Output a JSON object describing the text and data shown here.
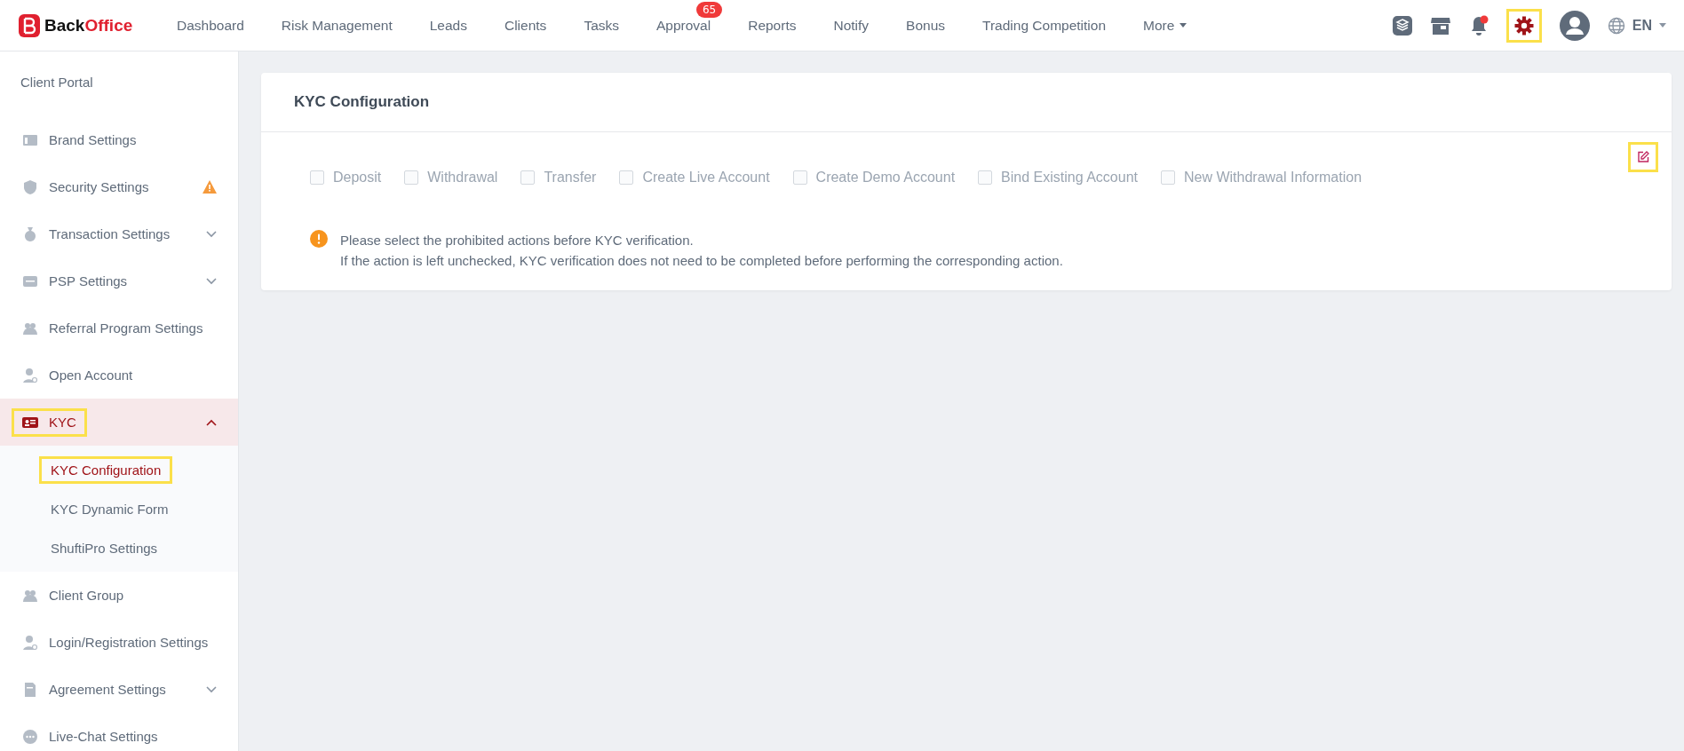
{
  "brand": {
    "name_plain": "Back",
    "name_accent": "Office"
  },
  "nav": [
    {
      "label": "Dashboard"
    },
    {
      "label": "Risk Management"
    },
    {
      "label": "Leads"
    },
    {
      "label": "Clients"
    },
    {
      "label": "Tasks"
    },
    {
      "label": "Approval",
      "badge": "65"
    },
    {
      "label": "Reports"
    },
    {
      "label": "Notify"
    },
    {
      "label": "Bonus"
    },
    {
      "label": "Trading Competition"
    },
    {
      "label": "More",
      "dropdown": true
    }
  ],
  "toolbar": {
    "notification_dot": true,
    "settings_highlighted": true,
    "language": "EN"
  },
  "sidebar": {
    "heading": "Client Portal",
    "items": [
      {
        "label": "Brand Settings",
        "kind": "link",
        "selected": false,
        "highlighted": false
      },
      {
        "label": "Security Settings",
        "kind": "link",
        "selected": false,
        "highlighted": false,
        "warning": true
      },
      {
        "label": "Transaction Settings",
        "kind": "group",
        "expanded": false,
        "selected": false,
        "highlighted": false
      },
      {
        "label": "PSP Settings",
        "kind": "group",
        "expanded": false,
        "selected": false,
        "highlighted": false
      },
      {
        "label": "Referral Program Settings",
        "kind": "link",
        "selected": false,
        "highlighted": false
      },
      {
        "label": "Open Account",
        "kind": "link",
        "selected": false,
        "highlighted": false
      },
      {
        "label": "KYC",
        "kind": "group",
        "expanded": true,
        "selected": true,
        "highlighted": true,
        "children": [
          {
            "label": "KYC Configuration",
            "selected": true,
            "highlighted": true
          },
          {
            "label": "KYC Dynamic Form",
            "selected": false,
            "highlighted": false
          },
          {
            "label": "ShuftiPro Settings",
            "selected": false,
            "highlighted": false
          }
        ]
      },
      {
        "label": "Client Group",
        "kind": "link",
        "selected": false,
        "highlighted": false
      },
      {
        "label": "Login/Registration Settings",
        "kind": "link",
        "selected": false,
        "highlighted": false
      },
      {
        "label": "Agreement Settings",
        "kind": "group",
        "expanded": false,
        "selected": false,
        "highlighted": false
      },
      {
        "label": "Live-Chat Settings",
        "kind": "link",
        "selected": false,
        "highlighted": false
      }
    ]
  },
  "card": {
    "title": "KYC Configuration",
    "edit_highlighted": true,
    "options": [
      {
        "label": "Deposit",
        "checked": false,
        "disabled": true
      },
      {
        "label": "Withdrawal",
        "checked": false,
        "disabled": true
      },
      {
        "label": "Transfer",
        "checked": false,
        "disabled": true
      },
      {
        "label": "Create Live Account",
        "checked": false,
        "disabled": true
      },
      {
        "label": "Create Demo Account",
        "checked": false,
        "disabled": true
      },
      {
        "label": "Bind Existing Account",
        "checked": false,
        "disabled": true
      },
      {
        "label": "New Withdrawal Information",
        "checked": false,
        "disabled": true
      }
    ],
    "notice": [
      "Please select the prohibited actions before KYC verification.",
      "If the action is left unchecked, KYC verification does not need to be completed before performing the corresponding action."
    ]
  }
}
